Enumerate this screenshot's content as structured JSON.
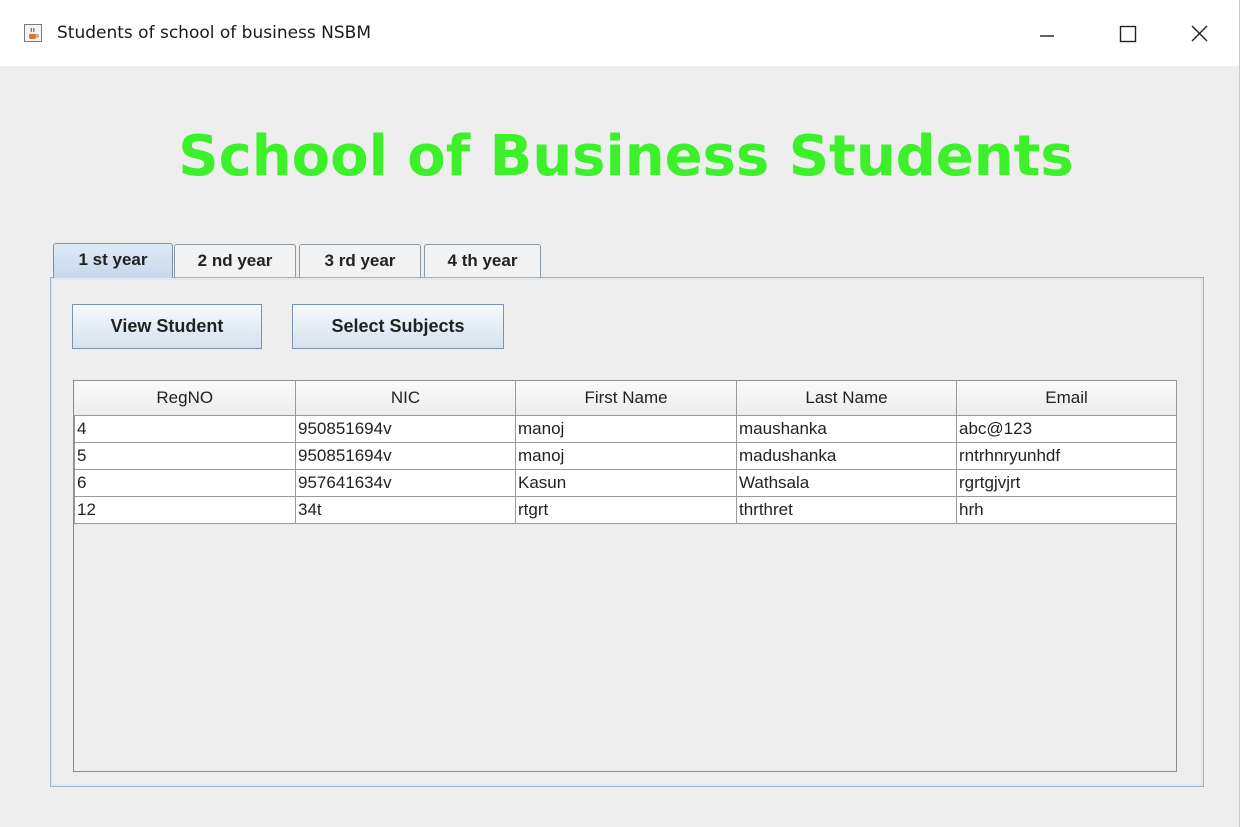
{
  "window": {
    "title": "Students of school of business NSBM",
    "icon": "java-cup-icon",
    "controls": [
      "minimize-icon",
      "maximize-icon",
      "close-icon"
    ]
  },
  "heading": "School of Business Students",
  "colors": {
    "heading": "#3cf02a",
    "active_tab": "#c7d8ea"
  },
  "tabs": [
    {
      "label": "1 st year",
      "active": true
    },
    {
      "label": "2 nd year",
      "active": false
    },
    {
      "label": "3 rd year",
      "active": false
    },
    {
      "label": "4 th year",
      "active": false
    }
  ],
  "buttons": {
    "view_student": "View Student",
    "select_subjects": "Select Subjects"
  },
  "table": {
    "columns": [
      "RegNO",
      "NIC",
      "First Name",
      "Last Name",
      "Email"
    ],
    "rows": [
      [
        "4",
        "950851694v",
        "manoj",
        "maushanka",
        "abc@123"
      ],
      [
        "5",
        "950851694v",
        "manoj",
        "madushanka",
        "rntrhnryunhdf"
      ],
      [
        "6",
        "957641634v",
        "Kasun",
        "Wathsala",
        "rgrtgjvjrt"
      ],
      [
        "12",
        "34t",
        "rtgrt",
        "thrthret",
        "hrh"
      ]
    ]
  }
}
